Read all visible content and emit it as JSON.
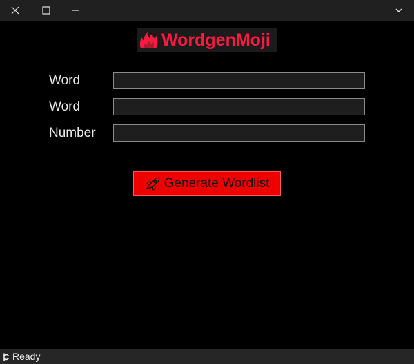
{
  "window": {
    "controls": [
      "close-icon",
      "maximize-icon",
      "minimize-icon",
      "chevron-down-icon"
    ]
  },
  "header": {
    "title": "WordgenMoji",
    "icon": "fire-icon",
    "title_color": "#ff1a40"
  },
  "form": {
    "fields": [
      {
        "label": "Word",
        "value": ""
      },
      {
        "label": "Word",
        "value": ""
      },
      {
        "label": "Number",
        "value": ""
      }
    ]
  },
  "actions": {
    "generate_label": "Generate Wordlist",
    "generate_icon": "rocket-icon",
    "generate_color": "#ee0000"
  },
  "status": {
    "text": "Ready",
    "icon": "status-icon"
  }
}
